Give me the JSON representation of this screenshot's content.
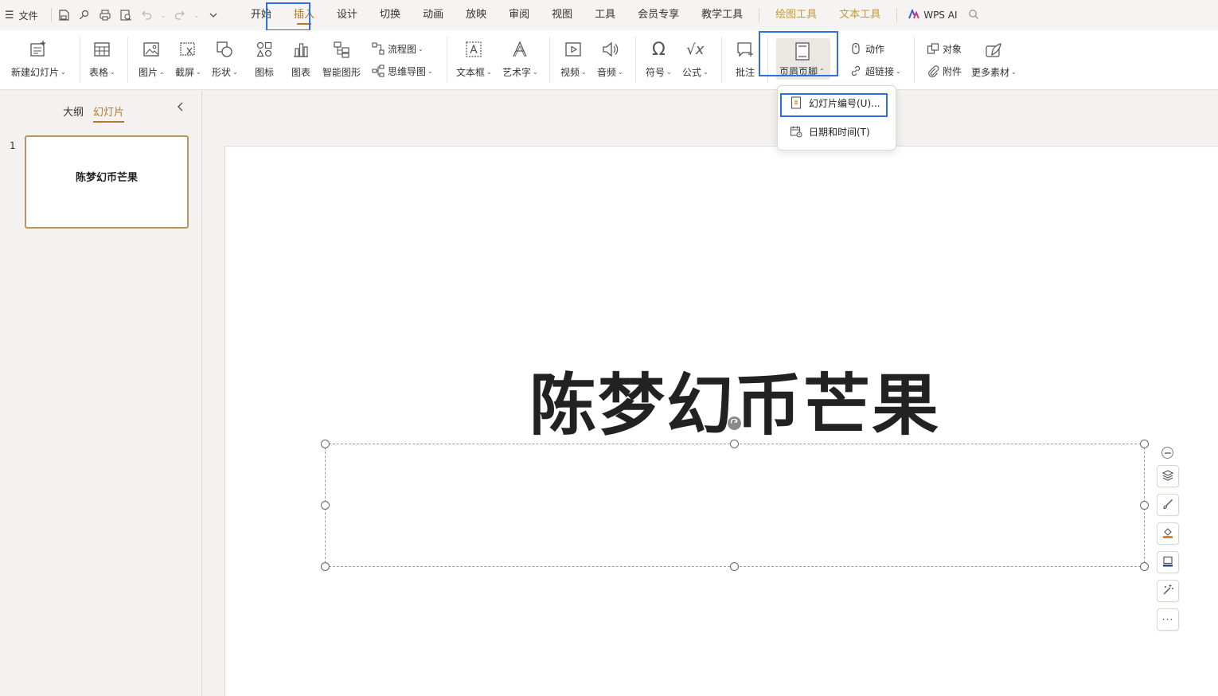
{
  "menubar": {
    "file_label": "文件",
    "tabs": [
      {
        "label": "开始"
      },
      {
        "label": "插入"
      },
      {
        "label": "设计"
      },
      {
        "label": "切换"
      },
      {
        "label": "动画"
      },
      {
        "label": "放映"
      },
      {
        "label": "审阅"
      },
      {
        "label": "视图"
      },
      {
        "label": "工具"
      },
      {
        "label": "会员专享"
      },
      {
        "label": "教学工具"
      }
    ],
    "context_tabs": [
      {
        "label": "绘图工具"
      },
      {
        "label": "文本工具"
      }
    ],
    "ai_label": "WPS AI",
    "active_tab": "插入"
  },
  "ribbon": {
    "new_slide": "新建幻灯片",
    "table": "表格",
    "picture": "图片",
    "screenshot": "截屏",
    "shape": "形状",
    "icon": "图标",
    "chart": "图表",
    "smart_art": "智能图形",
    "flowchart": "流程图",
    "mindmap": "思维导图",
    "textbox": "文本框",
    "wordart": "艺术字",
    "video": "视频",
    "audio": "音频",
    "symbol": "符号",
    "formula": "公式",
    "comment": "批注",
    "header_footer": "页眉页脚",
    "action": "动作",
    "hyperlink": "超链接",
    "object": "对象",
    "attachment": "附件",
    "more_material": "更多素材"
  },
  "dropdown": {
    "items": [
      {
        "label": "幻灯片编号(U)..."
      },
      {
        "label": "日期和时间(T)"
      }
    ]
  },
  "left_panel": {
    "tabs": [
      {
        "label": "大纲"
      },
      {
        "label": "幻灯片"
      }
    ],
    "slides": [
      {
        "number": "1",
        "title": "陈梦幻币芒果"
      }
    ]
  },
  "slide": {
    "title": "陈梦幻币芒果"
  },
  "colors": {
    "accent": "#b07c2b",
    "context_tab": "#c9992e",
    "highlight": "#2f6fe3"
  }
}
